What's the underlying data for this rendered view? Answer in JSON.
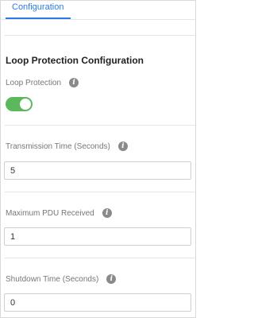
{
  "tabs": [
    {
      "label": "Configuration",
      "active": true
    }
  ],
  "section": {
    "title": "Loop Protection Configuration"
  },
  "loop_protection": {
    "label": "Loop Protection",
    "enabled": true
  },
  "transmission_time": {
    "label": "Transmission Time (Seconds)",
    "value": "5"
  },
  "max_pdu": {
    "label": "Maximum PDU Received",
    "value": "1"
  },
  "shutdown_time": {
    "label": "Shutdown Time (Seconds)",
    "value": "0"
  },
  "icons": {
    "info": "info-icon"
  },
  "colors": {
    "accent": "#2c7be5",
    "toggle_on": "#5cb85c",
    "info_icon": "#8a8a8a"
  }
}
